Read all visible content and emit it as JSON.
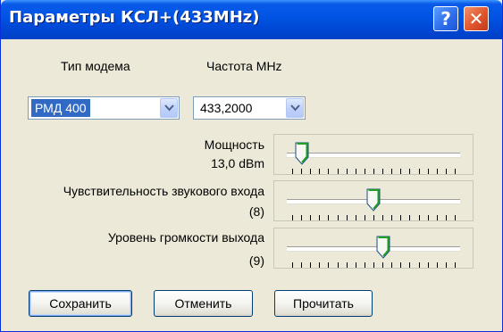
{
  "window": {
    "title": "Параметры КСЛ+(433MHz)",
    "help_label": "?",
    "close_label": "✕"
  },
  "modem": {
    "label": "Тип модема",
    "value": "РМД 400"
  },
  "frequency": {
    "label": "Частота MHz",
    "value": "433,2000"
  },
  "power": {
    "label": "Мощность",
    "value": "13,0 dBm",
    "level": 0.06
  },
  "input_sensitivity": {
    "label": "Чувствительность звукового входа",
    "value": "(8)",
    "level": 0.5
  },
  "output_volume": {
    "label": "Уровень громкости выхода",
    "value": "(9)",
    "level": 0.56
  },
  "buttons": {
    "save": "Сохранить",
    "cancel": "Отменить",
    "read": "Прочитать"
  },
  "colors": {
    "titlebar": "#0054e3",
    "dialog_bg": "#ece9d8",
    "selection": "#316ac5",
    "thumb_accent": "#21a121"
  }
}
